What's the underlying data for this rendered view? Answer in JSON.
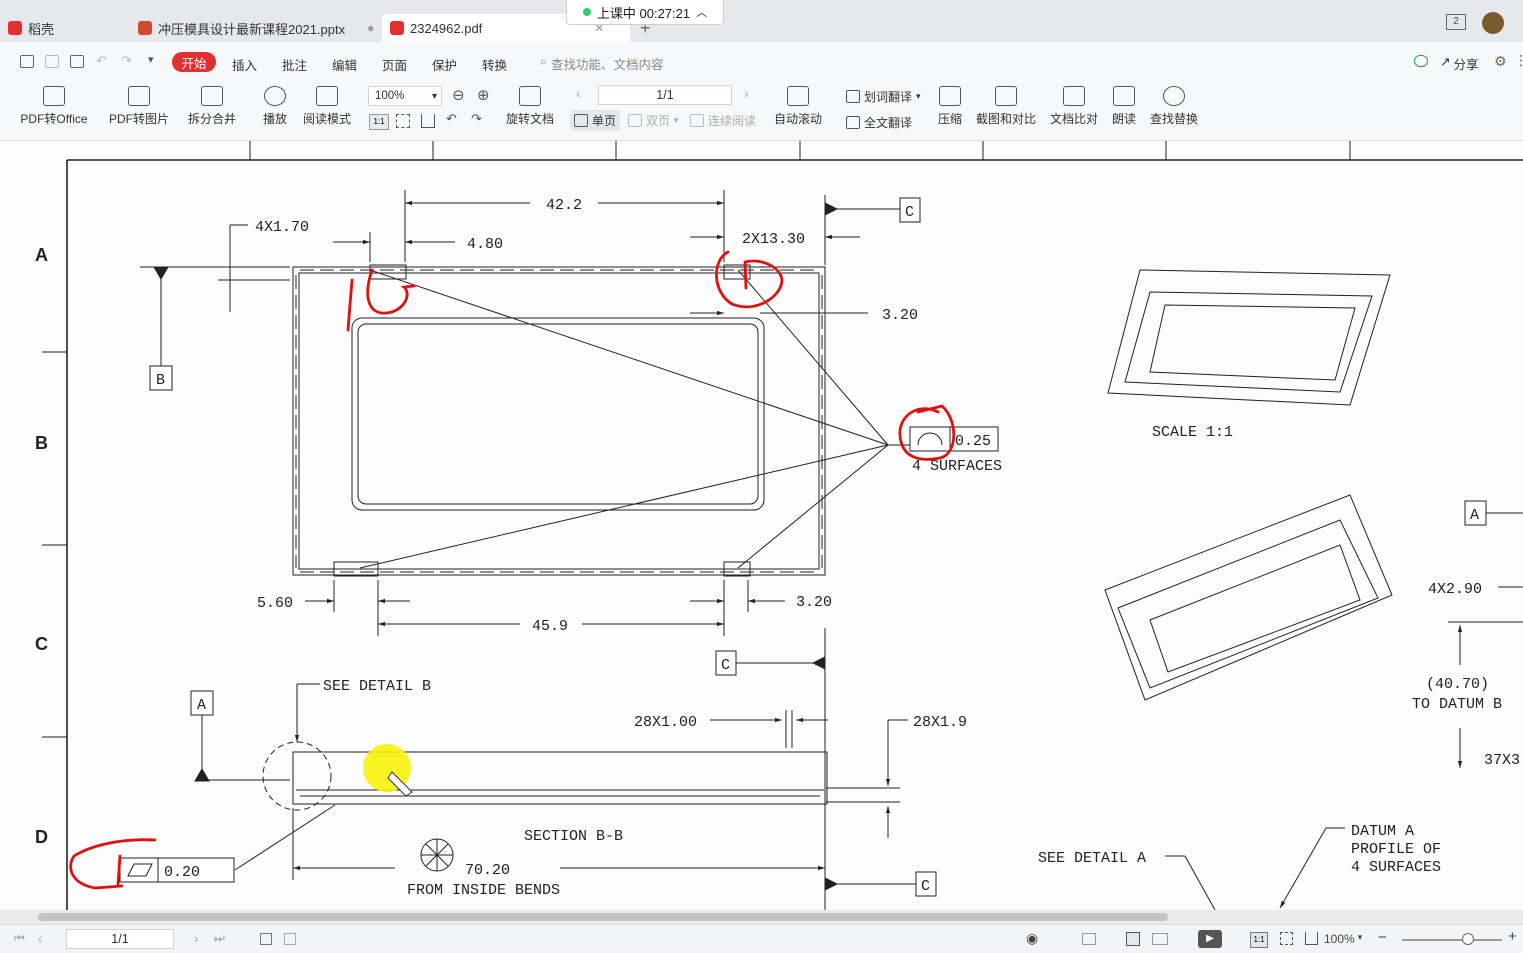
{
  "tabs": [
    {
      "label": "稻壳",
      "icon_color": "#e0302f",
      "active": false
    },
    {
      "label": "冲压模具设计最新课程2021.pptx",
      "icon_color": "#d04a2f",
      "active": false
    },
    {
      "label": "2324962.pdf",
      "icon_color": "#e0302f",
      "active": true
    }
  ],
  "recording": {
    "status": "上课中 00:27:21"
  },
  "window": {
    "badge": "2"
  },
  "menu": {
    "items": [
      "开始",
      "插入",
      "批注",
      "编辑",
      "页面",
      "保护",
      "转换"
    ],
    "search_placeholder": "查找功能、文档内容",
    "share": "分享"
  },
  "toolbar": {
    "pdf_to_office": "PDF转Office",
    "pdf_to_image": "PDF转图片",
    "split_merge": "拆分合并",
    "play": "播放",
    "read_mode": "阅读模式",
    "zoom": "100%",
    "rotate_doc": "旋转文档",
    "page": "1/1",
    "single_page": "单页",
    "double_page": "双页",
    "continuous": "连续阅读",
    "auto_scroll": "自动滚动",
    "word_translate": "划词翻译",
    "full_translate": "全文翻译",
    "compress": "压缩",
    "screenshot_compare": "截图和对比",
    "doc_compare": "文档比对",
    "read_aloud": "朗读",
    "find_replace": "查找替换"
  },
  "drawing": {
    "row_labels": [
      "A",
      "B",
      "C",
      "D"
    ],
    "dims": {
      "d422": "42.2",
      "d4x170": "4X1.70",
      "d480": "4.80",
      "d2x1330": "2X13.30",
      "d320a": "3.20",
      "d025": "0.25",
      "surfaces": "4 SURFACES",
      "d560": "5.60",
      "d459": "45.9",
      "d320b": "3.20",
      "scale": "SCALE  1:1",
      "d4x290": "4X2.90",
      "d4070": "(40.70)",
      "to_datum_b": "TO DATUM B",
      "d37x3": "37X3",
      "see_detail_b": "SEE DETAIL  B",
      "d28x100": "28X1.00",
      "d28x19": "28X1.9",
      "section": "SECTION  B-B",
      "d7020": "70.20",
      "from_inside": "FROM INSIDE BENDS",
      "d020": "0.20",
      "see_detail_a": "SEE DETAIL  A",
      "datum_a1": "DATUM A",
      "datum_a2": "PROFILE OF",
      "datum_a3": "4 SURFACES"
    },
    "datums": {
      "a": "A",
      "b": "B",
      "c": "C"
    }
  },
  "status": {
    "page": "1/1",
    "zoom": "100%"
  }
}
